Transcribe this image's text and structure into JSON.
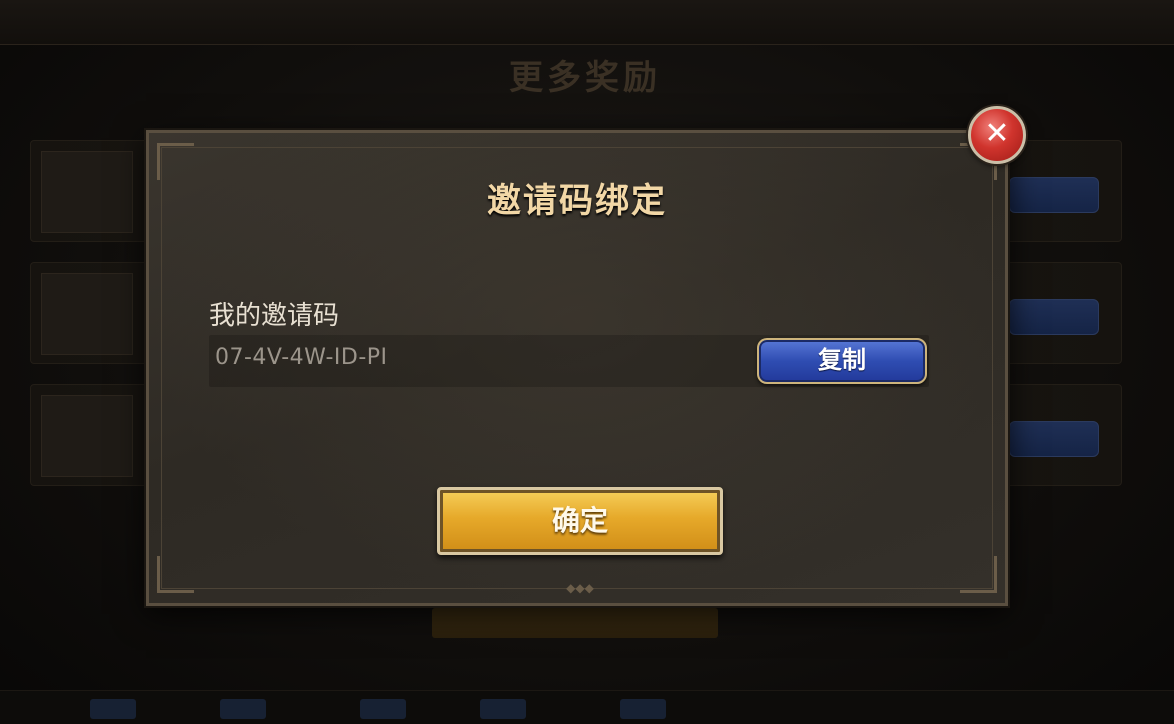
{
  "background": {
    "title": "更多奖励"
  },
  "dialog": {
    "title": "邀请码绑定",
    "field_label": "我的邀请码",
    "invite_code": "07-4V-4W-ID-PI",
    "copy_button": "复制",
    "confirm_button": "确定",
    "close_icon": "✕"
  },
  "colors": {
    "title_gold": "#f2d7a6",
    "copy_blue": "#2f4db2",
    "confirm_gold": "#e6a92a",
    "close_red": "#d0342d"
  },
  "icons": {
    "close": "close-icon"
  }
}
